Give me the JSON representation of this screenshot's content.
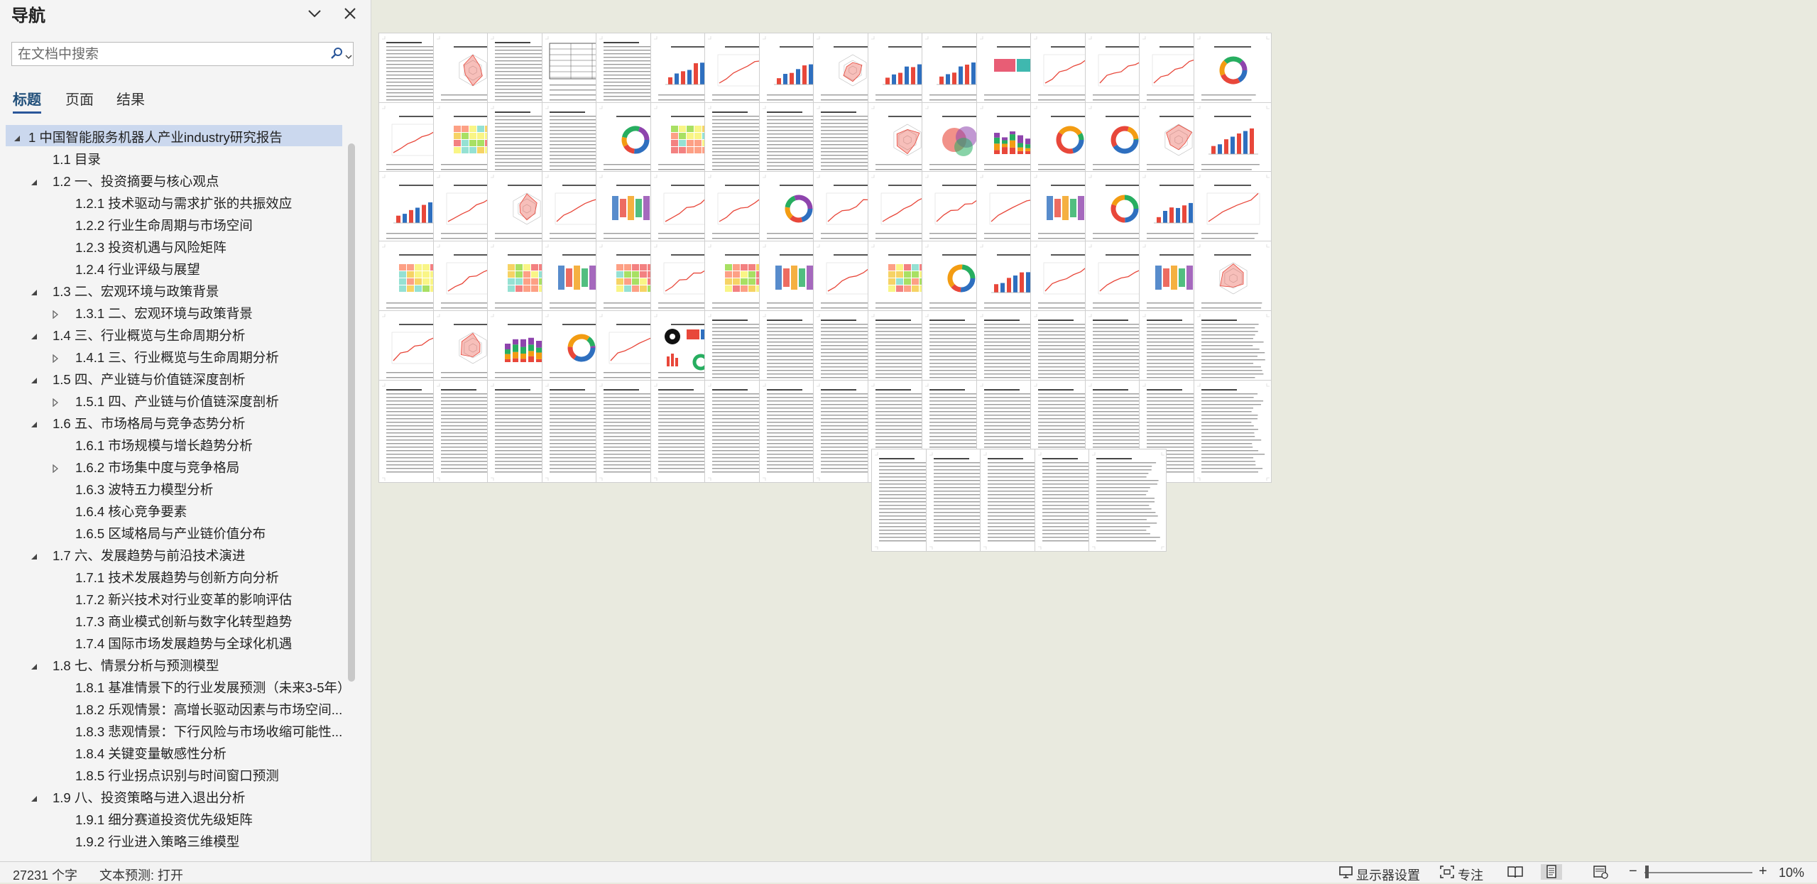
{
  "nav": {
    "title": "导航",
    "search_placeholder": "在文档中搜索",
    "tabs": [
      {
        "label": "标题",
        "active": true
      },
      {
        "label": "页面",
        "active": false
      },
      {
        "label": "结果",
        "active": false
      }
    ],
    "tree": [
      {
        "label": "1 中国智能服务机器人产业industry研究报告",
        "level": 0,
        "expander": "open",
        "selected": true
      },
      {
        "label": "1.1 目录",
        "level": 1,
        "expander": "none"
      },
      {
        "label": "1.2 一、投资摘要与核心观点",
        "level": 1,
        "expander": "open"
      },
      {
        "label": "1.2.1 技术驱动与需求扩张的共振效应",
        "level": 2,
        "expander": "none"
      },
      {
        "label": "1.2.2 行业生命周期与市场空间",
        "level": 2,
        "expander": "none"
      },
      {
        "label": "1.2.3 投资机遇与风险矩阵",
        "level": 2,
        "expander": "none"
      },
      {
        "label": "1.2.4 行业评级与展望",
        "level": 2,
        "expander": "none"
      },
      {
        "label": "1.3 二、宏观环境与政策背景",
        "level": 1,
        "expander": "open"
      },
      {
        "label": "1.3.1 二、宏观环境与政策背景",
        "level": 2,
        "expander": "closed"
      },
      {
        "label": "1.4 三、行业概览与生命周期分析",
        "level": 1,
        "expander": "open"
      },
      {
        "label": "1.4.1 三、行业概览与生命周期分析",
        "level": 2,
        "expander": "closed"
      },
      {
        "label": "1.5 四、产业链与价值链深度剖析",
        "level": 1,
        "expander": "open"
      },
      {
        "label": "1.5.1 四、产业链与价值链深度剖析",
        "level": 2,
        "expander": "closed"
      },
      {
        "label": "1.6 五、市场格局与竞争态势分析",
        "level": 1,
        "expander": "open"
      },
      {
        "label": "1.6.1 市场规模与增长趋势分析",
        "level": 2,
        "expander": "none"
      },
      {
        "label": "1.6.2 市场集中度与竞争格局",
        "level": 2,
        "expander": "closed"
      },
      {
        "label": "1.6.3 波特五力模型分析",
        "level": 2,
        "expander": "none"
      },
      {
        "label": "1.6.4 核心竞争要素",
        "level": 2,
        "expander": "none"
      },
      {
        "label": "1.6.5 区域格局与产业链价值分布",
        "level": 2,
        "expander": "none"
      },
      {
        "label": "1.7 六、发展趋势与前沿技术演进",
        "level": 1,
        "expander": "open"
      },
      {
        "label": "1.7.1 技术发展趋势与创新方向分析",
        "level": 2,
        "expander": "none"
      },
      {
        "label": "1.7.2 新兴技术对行业变革的影响评估",
        "level": 2,
        "expander": "none"
      },
      {
        "label": "1.7.3 商业模式创新与数字化转型趋势",
        "level": 2,
        "expander": "none"
      },
      {
        "label": "1.7.4 国际市场发展趋势与全球化机遇",
        "level": 2,
        "expander": "none"
      },
      {
        "label": "1.8 七、情景分析与预测模型",
        "level": 1,
        "expander": "open"
      },
      {
        "label": "1.8.1 基准情景下的行业发展预测（未来3-5年）",
        "level": 2,
        "expander": "none"
      },
      {
        "label": "1.8.2 乐观情景：高增长驱动因素与市场空间...",
        "level": 2,
        "expander": "none"
      },
      {
        "label": "1.8.3 悲观情景：下行风险与市场收缩可能性...",
        "level": 2,
        "expander": "none"
      },
      {
        "label": "1.8.4 关键变量敏感性分析",
        "level": 2,
        "expander": "none"
      },
      {
        "label": "1.8.5 行业拐点识别与时间窗口预测",
        "level": 2,
        "expander": "none"
      },
      {
        "label": "1.9 八、投资策略与进入退出分析",
        "level": 1,
        "expander": "open"
      },
      {
        "label": "1.9.1 细分赛道投资优先级矩阵",
        "level": 2,
        "expander": "none"
      },
      {
        "label": "1.9.2 行业进入策略三维模型",
        "level": 2,
        "expander": "none"
      }
    ]
  },
  "pages": {
    "rows": [
      [
        "text",
        "radar",
        "text",
        "table",
        "text",
        "bar",
        "line",
        "bar",
        "radar",
        "bar",
        "bar",
        "rect",
        "line",
        "line",
        "line",
        "donut"
      ],
      [
        "line",
        "heat",
        "text",
        "text",
        "donut",
        "heat",
        "text",
        "text",
        "text",
        "radar",
        "venn",
        "stack",
        "donut",
        "donut",
        "radar",
        "bar"
      ],
      [
        "bar",
        "line",
        "radar",
        "line",
        "sankey",
        "line",
        "line",
        "donut",
        "line",
        "line",
        "line",
        "line",
        "sankey",
        "donut",
        "bar",
        "line"
      ],
      [
        "heat",
        "line",
        "heat",
        "sankey",
        "heat",
        "line",
        "heat",
        "sankey",
        "line",
        "heat",
        "donut",
        "bar",
        "line",
        "line",
        "sankey",
        "radar"
      ],
      [
        "line",
        "radar",
        "stack",
        "donut",
        "line",
        "mixed",
        "text",
        "text",
        "text",
        "text",
        "text",
        "text",
        "text",
        "text",
        "text",
        "text"
      ],
      [
        "text",
        "text",
        "text",
        "text",
        "text",
        "text",
        "text",
        "text",
        "text",
        "text",
        "text",
        "text",
        "text",
        "text",
        "text",
        "text"
      ],
      [
        "text",
        "text",
        "text",
        "text",
        "text"
      ]
    ],
    "accent_colors": [
      "#2e6fbf",
      "#e8473a",
      "#f39c12",
      "#27ae60",
      "#8e44ad",
      "#16a085",
      "#e67e22",
      "#34495e"
    ]
  },
  "status": {
    "word_count": "27231 个字",
    "text_predict": "文本预测: 打开",
    "display_settings": "显示器设置",
    "focus": "专注",
    "zoom": "10%",
    "zoom_level": 0.02
  }
}
